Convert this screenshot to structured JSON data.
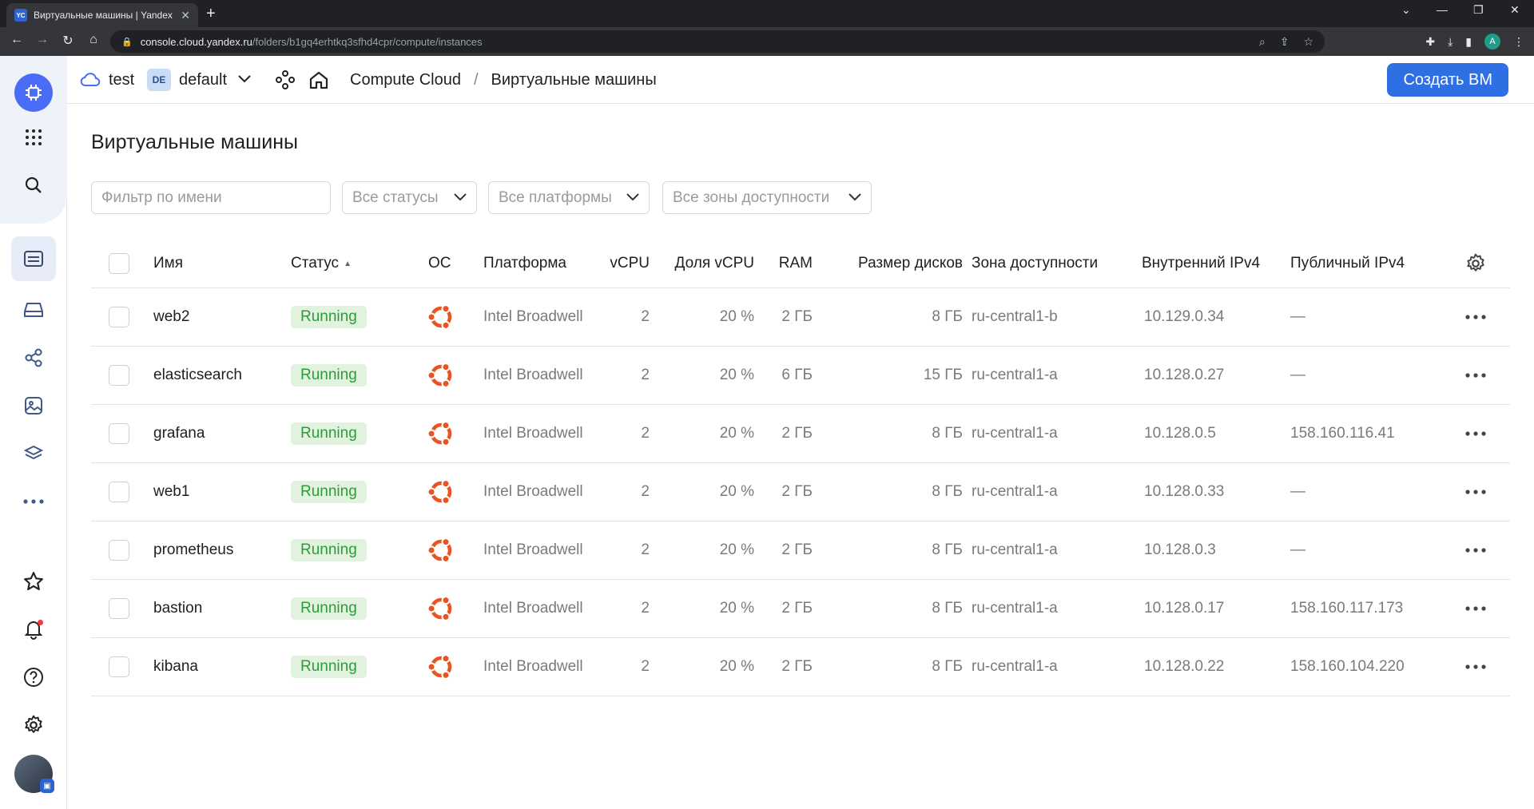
{
  "browser": {
    "tab_title": "Виртуальные машины | Yandex",
    "tab_favicon": "YC",
    "url_host": "console.cloud.yandex.ru",
    "url_path": "/folders/b1gq4erhtkq3sfhd4cpr/compute/instances",
    "profile_initial": "A"
  },
  "header": {
    "cloud": "test",
    "folder_badge": "DE",
    "folder": "default",
    "service": "Compute Cloud",
    "separator": "/",
    "page": "Виртуальные машины",
    "create_button": "Создать ВМ"
  },
  "main": {
    "title": "Виртуальные машины",
    "filters": {
      "name_placeholder": "Фильтр по имени",
      "status": "Все статусы",
      "platform": "Все платформы",
      "zone": "Все зоны доступности"
    },
    "columns": {
      "name": "Имя",
      "status": "Статус",
      "os": "ОС",
      "platform": "Платформа",
      "vcpu": "vCPU",
      "vcpu_share": "Доля vCPU",
      "ram": "RAM",
      "disk": "Размер дисков",
      "zone": "Зона доступности",
      "internal_ip": "Внутренний IPv4",
      "public_ip": "Публичный IPv4"
    },
    "rows": [
      {
        "name": "web2",
        "status": "Running",
        "platform": "Intel Broadwell",
        "vcpu": "2",
        "share": "20 %",
        "ram": "2 ГБ",
        "disk": "8 ГБ",
        "zone": "ru-central1-b",
        "ip": "10.129.0.34",
        "public": "—"
      },
      {
        "name": "elasticsearch",
        "status": "Running",
        "platform": "Intel Broadwell",
        "vcpu": "2",
        "share": "20 %",
        "ram": "6 ГБ",
        "disk": "15 ГБ",
        "zone": "ru-central1-a",
        "ip": "10.128.0.27",
        "public": "—"
      },
      {
        "name": "grafana",
        "status": "Running",
        "platform": "Intel Broadwell",
        "vcpu": "2",
        "share": "20 %",
        "ram": "2 ГБ",
        "disk": "8 ГБ",
        "zone": "ru-central1-a",
        "ip": "10.128.0.5",
        "public": "158.160.116.41"
      },
      {
        "name": "web1",
        "status": "Running",
        "platform": "Intel Broadwell",
        "vcpu": "2",
        "share": "20 %",
        "ram": "2 ГБ",
        "disk": "8 ГБ",
        "zone": "ru-central1-a",
        "ip": "10.128.0.33",
        "public": "—"
      },
      {
        "name": "prometheus",
        "status": "Running",
        "platform": "Intel Broadwell",
        "vcpu": "2",
        "share": "20 %",
        "ram": "2 ГБ",
        "disk": "8 ГБ",
        "zone": "ru-central1-a",
        "ip": "10.128.0.3",
        "public": "—"
      },
      {
        "name": "bastion",
        "status": "Running",
        "platform": "Intel Broadwell",
        "vcpu": "2",
        "share": "20 %",
        "ram": "2 ГБ",
        "disk": "8 ГБ",
        "zone": "ru-central1-a",
        "ip": "10.128.0.17",
        "public": "158.160.117.173"
      },
      {
        "name": "kibana",
        "status": "Running",
        "platform": "Intel Broadwell",
        "vcpu": "2",
        "share": "20 %",
        "ram": "2 ГБ",
        "disk": "8 ГБ",
        "zone": "ru-central1-a",
        "ip": "10.128.0.22",
        "public": "158.160.104.220"
      }
    ]
  },
  "colors": {
    "accent": "#2f6fe4",
    "status_running_bg": "#e1f3df",
    "status_running_text": "#2f9a39",
    "ubuntu_orange": "#e95420"
  },
  "icons": {
    "os": "ubuntu-icon",
    "settings": "gear-icon",
    "row_actions": "more-icon"
  }
}
